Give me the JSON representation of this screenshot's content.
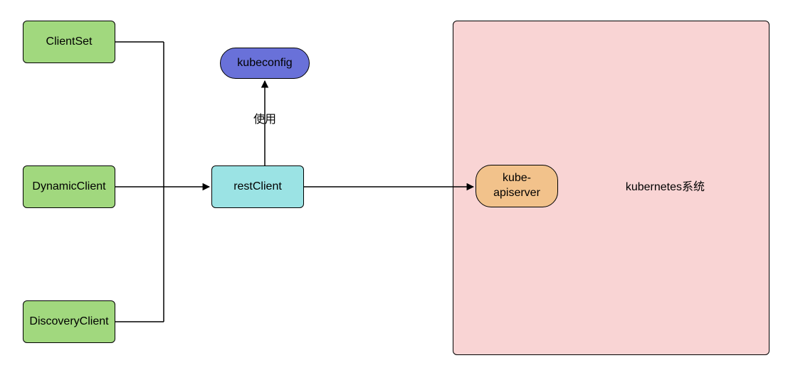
{
  "nodes": {
    "clientset": {
      "label": "ClientSet"
    },
    "dynamicclient": {
      "label": "DynamicClient"
    },
    "discoveryclient": {
      "label": "DiscoveryClient"
    },
    "restclient": {
      "label": "restClient"
    },
    "kubeconfig": {
      "label": "kubeconfig"
    },
    "kubeapiserver": {
      "label": "kube-apiserver"
    },
    "k8s_system": {
      "label": "kubernetes系统"
    }
  },
  "edges": {
    "uses_label": "使用"
  },
  "colors": {
    "green": "#a1d87e",
    "cyan": "#9be3e4",
    "blue": "#6971d9",
    "orange": "#f2c28b",
    "pink": "#f9d4d4"
  }
}
